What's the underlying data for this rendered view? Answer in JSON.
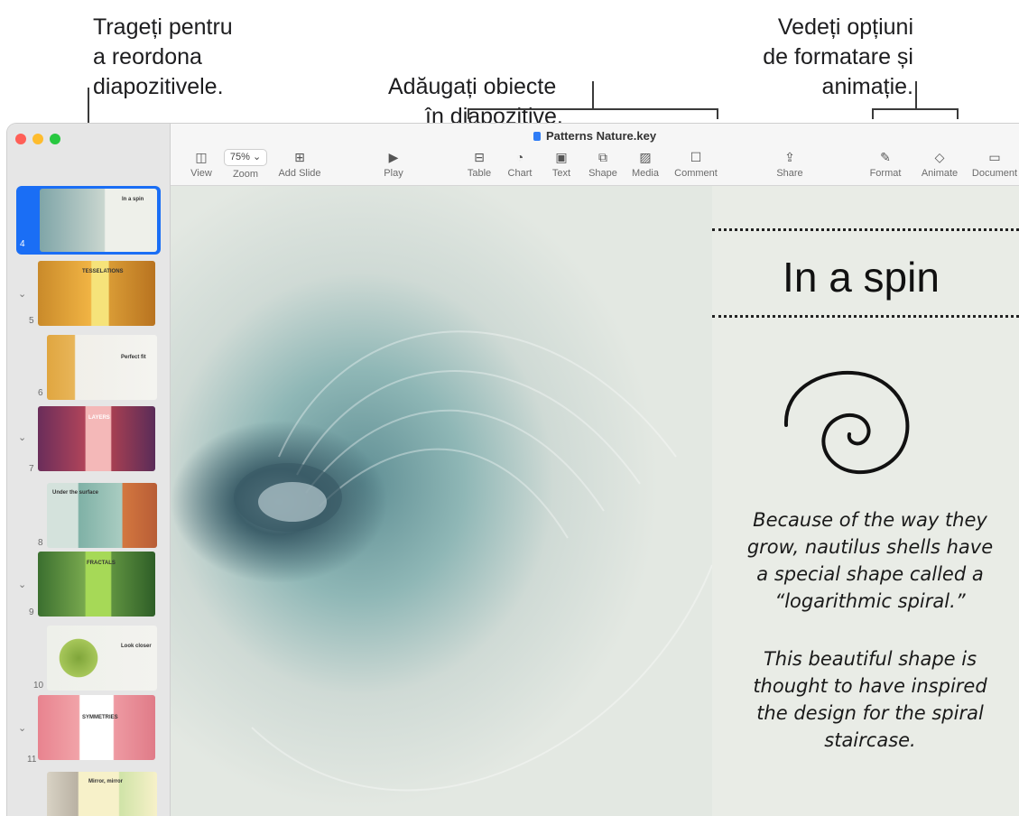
{
  "callouts": {
    "reorder": "Trageți pentru\na reordona\ndiapozitivele.",
    "add_objects_line1": "Adăugați obiecte",
    "add_objects_line2": "în diapozitive.",
    "format": "Vedeți opțiuni\nde formatare și\nanimație."
  },
  "window": {
    "title": "Patterns Nature.key"
  },
  "toolbar": {
    "zoom_value": "75%",
    "buttons": [
      {
        "label": "View",
        "icon": "sidebar-icon"
      },
      {
        "label": "Zoom",
        "icon": "zoom-icon"
      },
      {
        "label": "Add Slide",
        "icon": "plus-square-icon"
      },
      {
        "label": "Play",
        "icon": "play-icon"
      },
      {
        "label": "Table",
        "icon": "table-icon"
      },
      {
        "label": "Chart",
        "icon": "chart-icon"
      },
      {
        "label": "Text",
        "icon": "text-box-icon"
      },
      {
        "label": "Shape",
        "icon": "shape-icon"
      },
      {
        "label": "Media",
        "icon": "media-icon"
      },
      {
        "label": "Comment",
        "icon": "comment-icon"
      },
      {
        "label": "Share",
        "icon": "share-icon"
      },
      {
        "label": "Format",
        "icon": "paintbrush-icon"
      },
      {
        "label": "Animate",
        "icon": "diamond-icon"
      },
      {
        "label": "Document",
        "icon": "document-icon"
      }
    ]
  },
  "slide": {
    "title": "In a spin",
    "paragraph1": "Because of the way they grow, nautilus shells have a special shape called a “logarithmic spiral.”",
    "paragraph2": "This beautiful shape is thought to have inspired the design for the spiral staircase."
  },
  "navigator": {
    "slides": [
      {
        "number": "4",
        "title": "In a spin",
        "selected": true
      },
      {
        "number": "5",
        "title": "TESSELATIONS",
        "collapsible": true
      },
      {
        "number": "6",
        "title": "Perfect fit"
      },
      {
        "number": "7",
        "title": "LAYERS",
        "collapsible": true
      },
      {
        "number": "8",
        "title": "Under the surface"
      },
      {
        "number": "9",
        "title": "FRACTALS",
        "collapsible": true
      },
      {
        "number": "10",
        "title": "Look closer"
      },
      {
        "number": "11",
        "title": "SYMMETRIES",
        "collapsible": true
      },
      {
        "number": "",
        "title": "Mirror, mirror"
      }
    ]
  },
  "colors": {
    "selection": "#1a6ef5",
    "close": "#ff5f57",
    "minimize": "#febc2e",
    "zoom": "#28c840"
  }
}
